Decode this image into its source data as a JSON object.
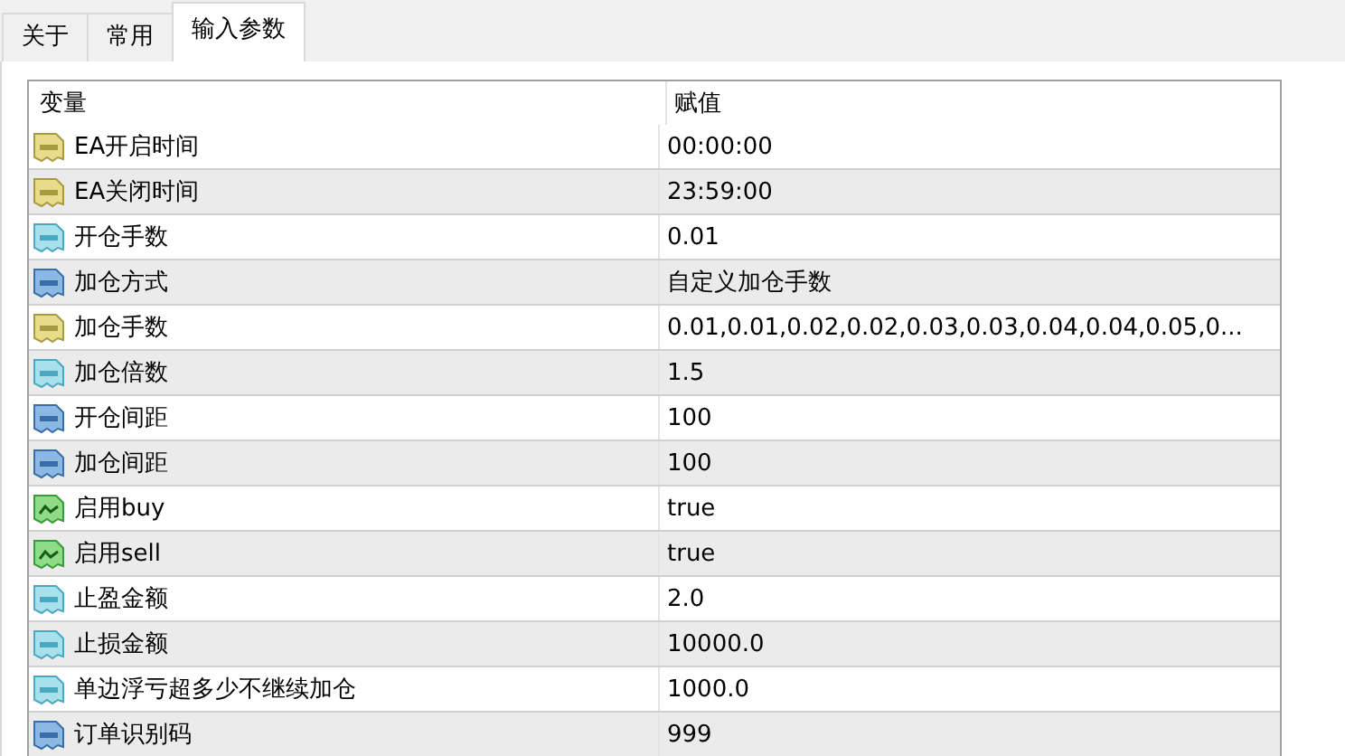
{
  "tabs": [
    {
      "label": "关于",
      "selected": false
    },
    {
      "label": "常用",
      "selected": false
    },
    {
      "label": "输入参数",
      "selected": true
    }
  ],
  "table": {
    "columns": [
      "变量",
      "赋值"
    ],
    "rows": [
      {
        "kind": "string",
        "name": "EA开启时间",
        "value": "00:00:00"
      },
      {
        "kind": "string",
        "name": "EA关闭时间",
        "value": "23:59:00"
      },
      {
        "kind": "double",
        "name": "开仓手数",
        "value": "0.01"
      },
      {
        "kind": "int",
        "name": "加仓方式",
        "value": "自定义加仓手数"
      },
      {
        "kind": "string",
        "name": "加仓手数",
        "value": "0.01,0.01,0.02,0.02,0.03,0.03,0.04,0.04,0.05,0..."
      },
      {
        "kind": "double",
        "name": "加仓倍数",
        "value": "1.5"
      },
      {
        "kind": "int",
        "name": "开仓间距",
        "value": "100"
      },
      {
        "kind": "int",
        "name": "加仓间距",
        "value": "100"
      },
      {
        "kind": "bool",
        "name": "启用buy",
        "value": "true"
      },
      {
        "kind": "bool",
        "name": "启用sell",
        "value": "true"
      },
      {
        "kind": "double",
        "name": "止盈金额",
        "value": "2.0"
      },
      {
        "kind": "double",
        "name": "止损金额",
        "value": "10000.0"
      },
      {
        "kind": "double",
        "name": "单边浮亏超多少不继续加仓",
        "value": "1000.0"
      },
      {
        "kind": "int",
        "name": "订单识别码",
        "value": "999"
      }
    ]
  }
}
